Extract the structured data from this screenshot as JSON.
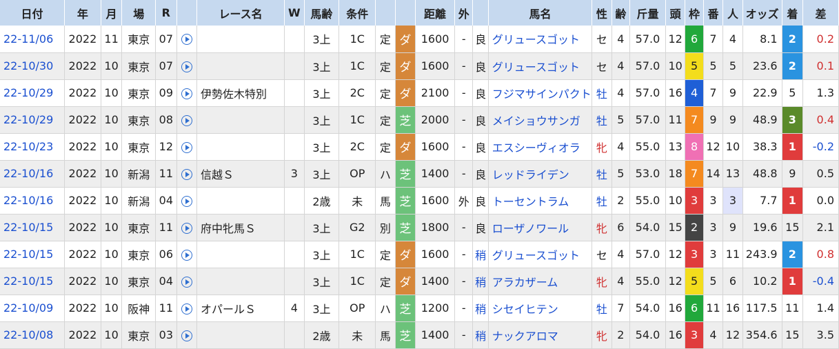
{
  "headers": [
    "日付",
    "年",
    "月",
    "場",
    "R",
    "",
    "レース名",
    "W",
    "馬齢",
    "条件",
    "",
    "",
    "距離",
    "外",
    "",
    "馬名",
    "性",
    "齢",
    "斤量",
    "頭",
    "枠",
    "番",
    "人",
    "オッズ",
    "着",
    "差"
  ],
  "colors": {
    "header_bg": "#c6d9ef",
    "dirt": "#d6873a",
    "turf": "#6cc27a",
    "link": "#1a4fd0"
  },
  "rows": [
    {
      "date": "22-11/06",
      "year": "2022",
      "month": "11",
      "place": "東京",
      "r": "07",
      "race": "",
      "w": "",
      "age": "3上",
      "cls": "1C",
      "wt": "定",
      "surf": "ダ",
      "dist": "1600",
      "out": "-",
      "cond": "良",
      "horse": "グリュースゴット",
      "sex": "セ",
      "hage": "4",
      "kin": "57.0",
      "heads": "12",
      "waku": "6",
      "ban": "7",
      "pop": "4",
      "odds": "8.1",
      "fin": "2",
      "diff": "0.2"
    },
    {
      "date": "22-10/30",
      "year": "2022",
      "month": "10",
      "place": "東京",
      "r": "07",
      "race": "",
      "w": "",
      "age": "3上",
      "cls": "1C",
      "wt": "定",
      "surf": "ダ",
      "dist": "1600",
      "out": "-",
      "cond": "良",
      "horse": "グリュースゴット",
      "sex": "セ",
      "hage": "4",
      "kin": "57.0",
      "heads": "10",
      "waku": "5",
      "ban": "5",
      "pop": "5",
      "odds": "23.6",
      "fin": "2",
      "diff": "0.1"
    },
    {
      "date": "22-10/29",
      "year": "2022",
      "month": "10",
      "place": "東京",
      "r": "09",
      "race": "伊勢佐木特別",
      "w": "",
      "age": "3上",
      "cls": "2C",
      "wt": "定",
      "surf": "ダ",
      "dist": "2100",
      "out": "-",
      "cond": "良",
      "horse": "フジマサインパクト",
      "sex": "牡",
      "hage": "4",
      "kin": "57.0",
      "heads": "16",
      "waku": "4",
      "ban": "7",
      "pop": "9",
      "odds": "22.9",
      "fin": "5",
      "diff": "1.3"
    },
    {
      "date": "22-10/29",
      "year": "2022",
      "month": "10",
      "place": "東京",
      "r": "08",
      "race": "",
      "w": "",
      "age": "3上",
      "cls": "1C",
      "wt": "定",
      "surf": "芝",
      "dist": "2000",
      "out": "-",
      "cond": "良",
      "horse": "メイショウサンガ",
      "sex": "牡",
      "hage": "5",
      "kin": "57.0",
      "heads": "11",
      "waku": "7",
      "ban": "9",
      "pop": "9",
      "odds": "48.9",
      "fin": "3",
      "diff": "0.4"
    },
    {
      "date": "22-10/23",
      "year": "2022",
      "month": "10",
      "place": "東京",
      "r": "12",
      "race": "",
      "w": "",
      "age": "3上",
      "cls": "2C",
      "wt": "定",
      "surf": "ダ",
      "dist": "1600",
      "out": "-",
      "cond": "良",
      "horse": "エスシーヴィオラ",
      "sex": "牝",
      "hage": "4",
      "kin": "55.0",
      "heads": "13",
      "waku": "8",
      "ban": "12",
      "pop": "10",
      "odds": "38.3",
      "fin": "1",
      "diff": "-0.2"
    },
    {
      "date": "22-10/16",
      "year": "2022",
      "month": "10",
      "place": "新潟",
      "r": "11",
      "race": "信越Ｓ",
      "w": "3",
      "age": "3上",
      "cls": "OP",
      "wt": "ハ",
      "surf": "芝",
      "dist": "1400",
      "out": "-",
      "cond": "良",
      "horse": "レッドライデン",
      "sex": "牡",
      "hage": "5",
      "kin": "53.0",
      "heads": "18",
      "waku": "7",
      "ban": "14",
      "pop": "13",
      "odds": "48.8",
      "fin": "9",
      "diff": "0.5"
    },
    {
      "date": "22-10/16",
      "year": "2022",
      "month": "10",
      "place": "新潟",
      "r": "04",
      "race": "",
      "w": "",
      "age": "2歳",
      "cls": "未",
      "wt": "馬",
      "surf": "芝",
      "dist": "1600",
      "out": "外",
      "cond": "良",
      "horse": "トーセントラム",
      "sex": "牡",
      "hage": "2",
      "kin": "55.0",
      "heads": "10",
      "waku": "3",
      "ban": "3",
      "pop": "3",
      "odds": "7.7",
      "fin": "1",
      "diff": "0.0"
    },
    {
      "date": "22-10/15",
      "year": "2022",
      "month": "10",
      "place": "東京",
      "r": "11",
      "race": "府中牝馬Ｓ",
      "w": "",
      "age": "3上",
      "cls": "G2",
      "wt": "別",
      "surf": "芝",
      "dist": "1800",
      "out": "-",
      "cond": "良",
      "horse": "ローザノワール",
      "sex": "牝",
      "hage": "6",
      "kin": "54.0",
      "heads": "15",
      "waku": "2",
      "ban": "3",
      "pop": "9",
      "odds": "19.6",
      "fin": "15",
      "diff": "2.1"
    },
    {
      "date": "22-10/15",
      "year": "2022",
      "month": "10",
      "place": "東京",
      "r": "06",
      "race": "",
      "w": "",
      "age": "3上",
      "cls": "1C",
      "wt": "定",
      "surf": "ダ",
      "dist": "1600",
      "out": "-",
      "cond": "稍",
      "horse": "グリュースゴット",
      "sex": "セ",
      "hage": "4",
      "kin": "57.0",
      "heads": "12",
      "waku": "3",
      "ban": "3",
      "pop": "11",
      "odds": "243.9",
      "fin": "2",
      "diff": "0.8"
    },
    {
      "date": "22-10/15",
      "year": "2022",
      "month": "10",
      "place": "東京",
      "r": "04",
      "race": "",
      "w": "",
      "age": "3上",
      "cls": "1C",
      "wt": "定",
      "surf": "ダ",
      "dist": "1400",
      "out": "-",
      "cond": "稍",
      "horse": "アラカザーム",
      "sex": "牝",
      "hage": "4",
      "kin": "55.0",
      "heads": "12",
      "waku": "5",
      "ban": "5",
      "pop": "6",
      "odds": "10.2",
      "fin": "1",
      "diff": "-0.4"
    },
    {
      "date": "22-10/09",
      "year": "2022",
      "month": "10",
      "place": "阪神",
      "r": "11",
      "race": "オパールＳ",
      "w": "4",
      "age": "3上",
      "cls": "OP",
      "wt": "ハ",
      "surf": "芝",
      "dist": "1200",
      "out": "-",
      "cond": "稍",
      "horse": "シセイヒテン",
      "sex": "牡",
      "hage": "7",
      "kin": "54.0",
      "heads": "16",
      "waku": "6",
      "ban": "11",
      "pop": "16",
      "odds": "117.5",
      "fin": "11",
      "diff": "1.4"
    },
    {
      "date": "22-10/08",
      "year": "2022",
      "month": "10",
      "place": "東京",
      "r": "03",
      "race": "",
      "w": "",
      "age": "2歳",
      "cls": "未",
      "wt": "馬",
      "surf": "芝",
      "dist": "1400",
      "out": "-",
      "cond": "稍",
      "horse": "ナックアロマ",
      "sex": "牝",
      "hage": "2",
      "kin": "54.0",
      "heads": "16",
      "waku": "3",
      "ban": "4",
      "pop": "12",
      "odds": "354.6",
      "fin": "15",
      "diff": "3.5"
    }
  ]
}
